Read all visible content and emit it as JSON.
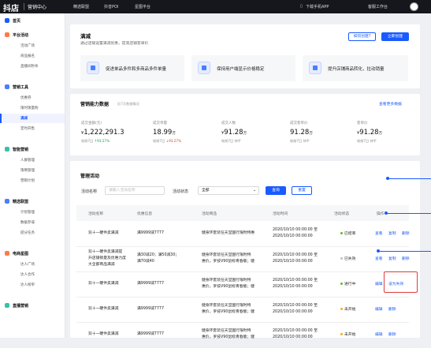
{
  "topbar": {
    "logo": "抖店",
    "app_name": "营销中心",
    "nav": [
      "精选联盟",
      "抖音POI",
      "星图平台"
    ],
    "download": "下载手机APP",
    "workbench": "客服工作台"
  },
  "sidebar": {
    "items": [
      {
        "label": "首页",
        "type": "h",
        "color": "#1a5bff"
      },
      {
        "label": "平台活动",
        "type": "h",
        "color": "#ff7a45"
      },
      {
        "label": "活动广场",
        "type": "sub"
      },
      {
        "label": "商品报名",
        "type": "sub"
      },
      {
        "label": "直播间秒杀",
        "type": "sub"
      },
      {
        "label": "营销工具",
        "type": "h",
        "color": "#4a7dff"
      },
      {
        "label": "优惠券",
        "type": "sub"
      },
      {
        "label": "限时限量购",
        "type": "sub"
      },
      {
        "label": "满减",
        "type": "sub",
        "active": true
      },
      {
        "label": "定时开售",
        "type": "sub"
      },
      {
        "label": "智能营销",
        "type": "h",
        "color": "#36c2a8"
      },
      {
        "label": "人群管理",
        "type": "sub"
      },
      {
        "label": "策略管理",
        "type": "sub"
      },
      {
        "label": "营销计划",
        "type": "sub"
      },
      {
        "label": "精选联盟",
        "type": "h",
        "color": "#4a7dff"
      },
      {
        "label": "计划管理",
        "type": "sub"
      },
      {
        "label": "数据参谋",
        "type": "sub"
      },
      {
        "label": "提分任务",
        "type": "sub"
      },
      {
        "label": "电商星图",
        "type": "h",
        "color": "#ff7a45"
      },
      {
        "label": "达人广场",
        "type": "sub"
      },
      {
        "label": "达人合作",
        "type": "sub"
      },
      {
        "label": "达人榜单",
        "type": "sub"
      },
      {
        "label": "直播营销",
        "type": "h",
        "color": "#36c2a8"
      }
    ]
  },
  "header": {
    "title": "满减",
    "subtitle": "通过店铺设置满减优惠，提高店铺客单价",
    "how_to_create": "如何创建?",
    "create_now": "立即创建",
    "features": [
      "促进单品多件和多商品多件单量",
      "保持用户端显示价格稳定",
      "提升店铺商品转化，拉动销量"
    ]
  },
  "capability": {
    "title": "营销能力数据",
    "period": "近7天数据情况",
    "view_more": "查看更多数据",
    "stats": [
      {
        "label": "成交金额(元)",
        "currency": "¥",
        "value": "1,222,291.3",
        "unit": "",
        "change_label": "较前7日",
        "change": "93.27%",
        "trend": "up"
      },
      {
        "label": "成交单量",
        "currency": "",
        "value": "18.99",
        "unit": "万",
        "change_label": "较前7日",
        "change": "93.27%",
        "trend": "down"
      },
      {
        "label": "成交人数",
        "currency": "¥",
        "value": "91.28",
        "unit": "万",
        "change_label": "较前7日",
        "change": "持平",
        "trend": "flat"
      },
      {
        "label": "成交客单价",
        "currency": "",
        "value": "91.28",
        "unit": "万",
        "change_label": "较前7日",
        "change": "持平",
        "trend": "flat"
      },
      {
        "label": "客单价",
        "currency": "¥",
        "value": "91.28",
        "unit": "万",
        "change_label": "较前7日",
        "change": "持平",
        "trend": "flat"
      }
    ]
  },
  "manage": {
    "title": "管理活动",
    "name_label": "活动名称",
    "name_placeholder": "请输入活动名称",
    "status_label": "活动状态",
    "status_value": "全部",
    "query": "查询",
    "reset": "重置",
    "columns": [
      "活动名称",
      "优惠信息",
      "活动商品",
      "活动时间",
      "活动状态",
      "操作"
    ],
    "rows": [
      {
        "name": [
          "双十一硬件卖满减"
        ],
        "offer": [
          "满9999减7777"
        ],
        "goods": [
          "健身环套装任天堂国行限时特惠"
        ],
        "time": [
          "2020/10/10 00:00:00 至",
          "2020/10/10 00:00:00"
        ],
        "status": "已结束",
        "status_color": "#52c41a",
        "actions": [
          "查看",
          "复制",
          "删除"
        ]
      },
      {
        "name": [
          "双十一硬件卖满减提",
          "升店铺销量及优惠力度",
          "大全部商品满减"
        ],
        "offer": [
          "满30减20；满50减30；",
          "满70减40"
        ],
        "goods": [
          "健身环套装任天堂国行限时特",
          "惠价，罗技V90鼠标青春版；健"
        ],
        "time": [
          "2020/10/10 00:00:00 至",
          "2020/10/10 00:00:00"
        ],
        "status": "已失效",
        "status_color": "#bfbfbf",
        "actions": [
          "查看",
          "复制",
          "删除"
        ]
      },
      {
        "name": [
          "双十一硬件卖满减"
        ],
        "offer": [
          "满9999减7777"
        ],
        "goods": [
          "健身环套装任天堂国行限时特",
          "惠价，罗技V90鼠标青春版；健"
        ],
        "time": [
          "2020/10/10 00:00:00 至",
          "2020/10/10 00:00:00"
        ],
        "status": "进行中",
        "status_color": "#52c41a",
        "actions": [
          "编辑",
          "设为失效"
        ]
      },
      {
        "name": [
          "双十一硬件卖满减"
        ],
        "offer": [
          "满9999减7777"
        ],
        "goods": [
          "健身环套装任天堂国行限时特",
          "惠价，罗技V90鼠标青春版；健"
        ],
        "time": [
          "2020/10/10 00:00:00 至",
          "2020/10/10 00:00:00"
        ],
        "status": "未开始",
        "status_color": "#faad14",
        "actions": [
          "编辑",
          "删除"
        ]
      },
      {
        "name": [
          "双十一硬件卖满减"
        ],
        "offer": [
          "满9999减7777"
        ],
        "goods": [
          "健身环套装任天堂国行限时特",
          "惠价，罗技V90鼠标青春版；健"
        ],
        "time": [
          "2020/10/10 00:00:00 至",
          "2020/10/10 00:00:00"
        ],
        "status": "未开始",
        "status_color": "#faad14",
        "actions": [
          "编辑",
          "删除"
        ]
      }
    ]
  }
}
